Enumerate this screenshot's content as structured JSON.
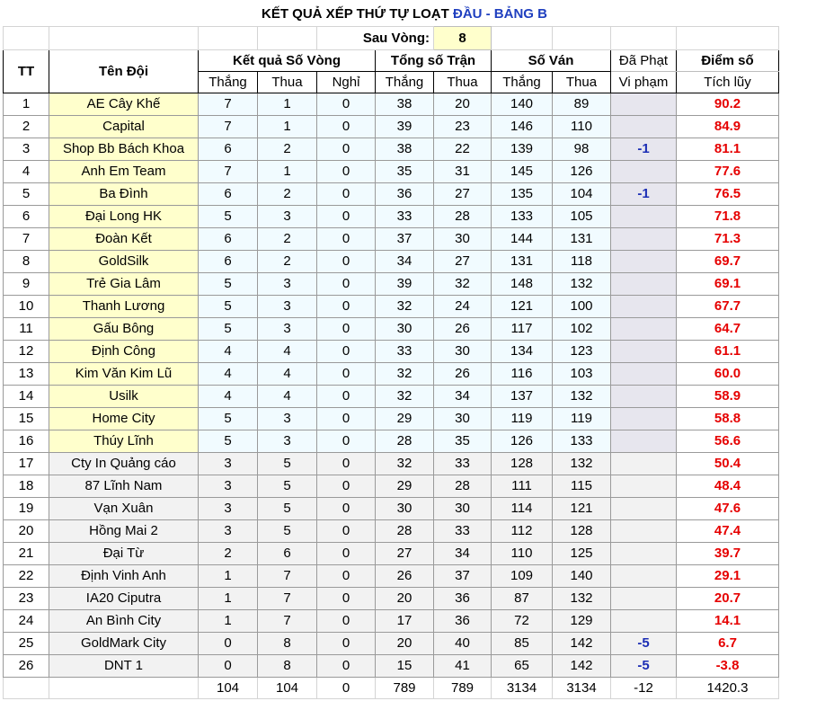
{
  "header": {
    "title_main": "KẾT QUẢ XẾP THỨ TỰ LOẠT",
    "title_accent": "ĐẦU - BẢNG B",
    "round_label": "Sau Vòng:",
    "round_value": "8"
  },
  "columns": {
    "tt": "TT",
    "team": "Tên Đội",
    "round_results": "Kết quả Số Vòng",
    "matches": "Tổng số Trận",
    "games": "Số Ván",
    "penalty": "Đã Phạt",
    "points": "Điểm số",
    "win": "Thắng",
    "loss": "Thua",
    "rest": "Nghỉ",
    "violation": "Vi phạm",
    "cumulative": "Tích lũy"
  },
  "rows": [
    {
      "tt": "1",
      "team": "AE Cây Khế",
      "w": "7",
      "l": "1",
      "r": "0",
      "mw": "38",
      "ml": "20",
      "gw": "140",
      "gl": "89",
      "pen": "",
      "pts": "90.2"
    },
    {
      "tt": "2",
      "team": "Capital",
      "w": "7",
      "l": "1",
      "r": "0",
      "mw": "39",
      "ml": "23",
      "gw": "146",
      "gl": "110",
      "pen": "",
      "pts": "84.9"
    },
    {
      "tt": "3",
      "team": "Shop Bb Bách Khoa",
      "w": "6",
      "l": "2",
      "r": "0",
      "mw": "38",
      "ml": "22",
      "gw": "139",
      "gl": "98",
      "pen": "-1",
      "pts": "81.1"
    },
    {
      "tt": "4",
      "team": "Anh Em Team",
      "w": "7",
      "l": "1",
      "r": "0",
      "mw": "35",
      "ml": "31",
      "gw": "145",
      "gl": "126",
      "pen": "",
      "pts": "77.6"
    },
    {
      "tt": "5",
      "team": "Ba Đình",
      "w": "6",
      "l": "2",
      "r": "0",
      "mw": "36",
      "ml": "27",
      "gw": "135",
      "gl": "104",
      "pen": "-1",
      "pts": "76.5"
    },
    {
      "tt": "6",
      "team": "Đại Long HK",
      "w": "5",
      "l": "3",
      "r": "0",
      "mw": "33",
      "ml": "28",
      "gw": "133",
      "gl": "105",
      "pen": "",
      "pts": "71.8"
    },
    {
      "tt": "7",
      "team": "Đoàn Kết",
      "w": "6",
      "l": "2",
      "r": "0",
      "mw": "37",
      "ml": "30",
      "gw": "144",
      "gl": "131",
      "pen": "",
      "pts": "71.3"
    },
    {
      "tt": "8",
      "team": "GoldSilk",
      "w": "6",
      "l": "2",
      "r": "0",
      "mw": "34",
      "ml": "27",
      "gw": "131",
      "gl": "118",
      "pen": "",
      "pts": "69.7"
    },
    {
      "tt": "9",
      "team": "Trẻ Gia Lâm",
      "w": "5",
      "l": "3",
      "r": "0",
      "mw": "39",
      "ml": "32",
      "gw": "148",
      "gl": "132",
      "pen": "",
      "pts": "69.1"
    },
    {
      "tt": "10",
      "team": "Thanh Lương",
      "w": "5",
      "l": "3",
      "r": "0",
      "mw": "32",
      "ml": "24",
      "gw": "121",
      "gl": "100",
      "pen": "",
      "pts": "67.7"
    },
    {
      "tt": "11",
      "team": "Gấu Bông",
      "w": "5",
      "l": "3",
      "r": "0",
      "mw": "30",
      "ml": "26",
      "gw": "117",
      "gl": "102",
      "pen": "",
      "pts": "64.7"
    },
    {
      "tt": "12",
      "team": "Định Công",
      "w": "4",
      "l": "4",
      "r": "0",
      "mw": "33",
      "ml": "30",
      "gw": "134",
      "gl": "123",
      "pen": "",
      "pts": "61.1"
    },
    {
      "tt": "13",
      "team": "Kim Văn Kim Lũ",
      "w": "4",
      "l": "4",
      "r": "0",
      "mw": "32",
      "ml": "26",
      "gw": "116",
      "gl": "103",
      "pen": "",
      "pts": "60.0"
    },
    {
      "tt": "14",
      "team": "Usilk",
      "w": "4",
      "l": "4",
      "r": "0",
      "mw": "32",
      "ml": "34",
      "gw": "137",
      "gl": "132",
      "pen": "",
      "pts": "58.9"
    },
    {
      "tt": "15",
      "team": "Home City",
      "w": "5",
      "l": "3",
      "r": "0",
      "mw": "29",
      "ml": "30",
      "gw": "119",
      "gl": "119",
      "pen": "",
      "pts": "58.8"
    },
    {
      "tt": "16",
      "team": "Thúy Lĩnh",
      "w": "5",
      "l": "3",
      "r": "0",
      "mw": "28",
      "ml": "35",
      "gw": "126",
      "gl": "133",
      "pen": "",
      "pts": "56.6"
    },
    {
      "tt": "17",
      "team": "Cty In Quảng cáo",
      "w": "3",
      "l": "5",
      "r": "0",
      "mw": "32",
      "ml": "33",
      "gw": "128",
      "gl": "132",
      "pen": "",
      "pts": "50.4"
    },
    {
      "tt": "18",
      "team": "87 Lĩnh Nam",
      "w": "3",
      "l": "5",
      "r": "0",
      "mw": "29",
      "ml": "28",
      "gw": "111",
      "gl": "115",
      "pen": "",
      "pts": "48.4"
    },
    {
      "tt": "19",
      "team": "Vạn Xuân",
      "w": "3",
      "l": "5",
      "r": "0",
      "mw": "30",
      "ml": "30",
      "gw": "114",
      "gl": "121",
      "pen": "",
      "pts": "47.6"
    },
    {
      "tt": "20",
      "team": "Hồng Mai 2",
      "w": "3",
      "l": "5",
      "r": "0",
      "mw": "28",
      "ml": "33",
      "gw": "112",
      "gl": "128",
      "pen": "",
      "pts": "47.4"
    },
    {
      "tt": "21",
      "team": "Đại Từ",
      "w": "2",
      "l": "6",
      "r": "0",
      "mw": "27",
      "ml": "34",
      "gw": "110",
      "gl": "125",
      "pen": "",
      "pts": "39.7"
    },
    {
      "tt": "22",
      "team": "Định Vinh Anh",
      "w": "1",
      "l": "7",
      "r": "0",
      "mw": "26",
      "ml": "37",
      "gw": "109",
      "gl": "140",
      "pen": "",
      "pts": "29.1"
    },
    {
      "tt": "23",
      "team": "IA20 Ciputra",
      "w": "1",
      "l": "7",
      "r": "0",
      "mw": "20",
      "ml": "36",
      "gw": "87",
      "gl": "132",
      "pen": "",
      "pts": "20.7"
    },
    {
      "tt": "24",
      "team": "An Bình City",
      "w": "1",
      "l": "7",
      "r": "0",
      "mw": "17",
      "ml": "36",
      "gw": "72",
      "gl": "129",
      "pen": "",
      "pts": "14.1"
    },
    {
      "tt": "25",
      "team": "GoldMark City",
      "w": "0",
      "l": "8",
      "r": "0",
      "mw": "20",
      "ml": "40",
      "gw": "85",
      "gl": "142",
      "pen": "-5",
      "pts": "6.7"
    },
    {
      "tt": "26",
      "team": "DNT 1",
      "w": "0",
      "l": "8",
      "r": "0",
      "mw": "15",
      "ml": "41",
      "gw": "65",
      "gl": "142",
      "pen": "-5",
      "pts": "-3.8"
    }
  ],
  "totals": {
    "w": "104",
    "l": "104",
    "r": "0",
    "mw": "789",
    "ml": "789",
    "gw": "3134",
    "gl": "3134",
    "pen": "-12",
    "pts": "1420.3"
  },
  "colors": {
    "accent_blue": "#1f3fbf",
    "score_red": "#e60000",
    "penalty_blue": "#1d2fb5",
    "team_highlight": "#ffffcc",
    "data_highlight": "#f1fbff",
    "penalty_box": "#e7e6ee",
    "lower_rows": "#f2f2f2"
  }
}
